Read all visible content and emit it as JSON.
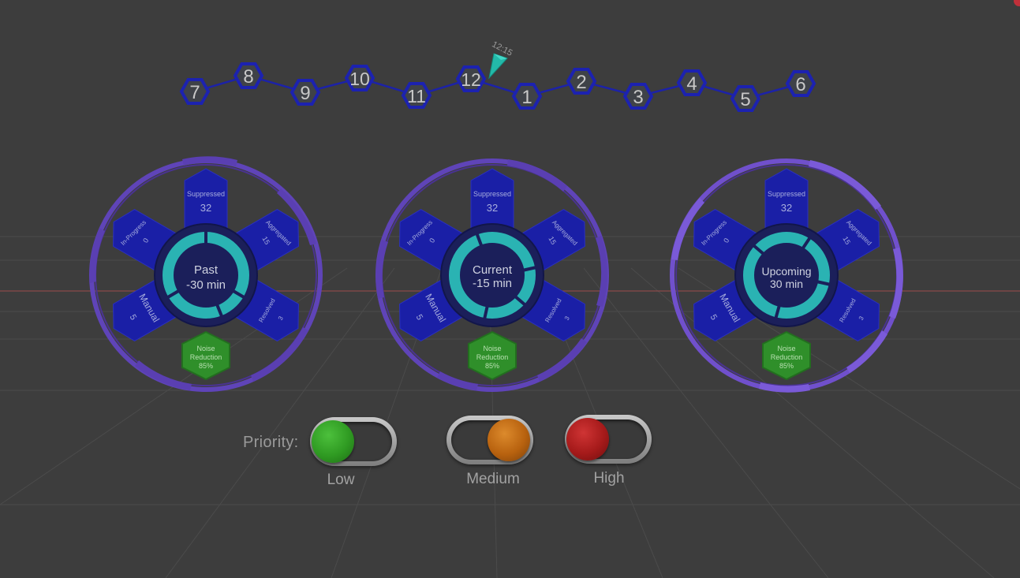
{
  "timeline": {
    "marker_label": "12:15",
    "hours": [
      "7",
      "8",
      "9",
      "10",
      "11",
      "12",
      "1",
      "2",
      "3",
      "4",
      "5",
      "6"
    ]
  },
  "dials": [
    {
      "center_line1": "Past",
      "center_line2": "-30 min",
      "suppressed_label": "Suppressed",
      "suppressed_value": "32",
      "inprogress_label": "In-Progress",
      "inprogress_value": "0",
      "aggregated_label": "Aggregated",
      "aggregated_value": "15",
      "manual_label": "Manual",
      "manual_value": "5",
      "resolved_label": "Resolved",
      "resolved_value": "3",
      "noise_line1": "Noise",
      "noise_line2": "Reduction",
      "noise_value": "85%"
    },
    {
      "center_line1": "Current",
      "center_line2": "-15 min",
      "suppressed_label": "Suppressed",
      "suppressed_value": "32",
      "inprogress_label": "In-Progress",
      "inprogress_value": "0",
      "aggregated_label": "Aggregated",
      "aggregated_value": "15",
      "manual_label": "Manual",
      "manual_value": "5",
      "resolved_label": "Resolved",
      "resolved_value": "3",
      "noise_line1": "Noise",
      "noise_line2": "Reduction",
      "noise_value": "85%"
    },
    {
      "center_line1": "Upcoming",
      "center_line2": "30 min",
      "suppressed_label": "Suppressed",
      "suppressed_value": "32",
      "inprogress_label": "In-Progress",
      "inprogress_value": "0",
      "aggregated_label": "Aggregated",
      "aggregated_value": "15",
      "manual_label": "Manual",
      "manual_value": "5",
      "resolved_label": "Resolved",
      "resolved_value": "3",
      "noise_line1": "Noise",
      "noise_line2": "Reduction",
      "noise_value": "85%"
    }
  ],
  "priority": {
    "label": "Priority:",
    "low_label": "Low",
    "medium_label": "Medium",
    "high_label": "High",
    "low_color": "#2f9a22",
    "medium_color": "#b8620f",
    "high_color": "#a51a1a"
  },
  "colors": {
    "background": "#3d3d3d",
    "hex_blue": "#1a1f9e",
    "ring_purple": "#6a4fc0",
    "teal": "#2ab3b3",
    "green": "#2f8f2a"
  }
}
